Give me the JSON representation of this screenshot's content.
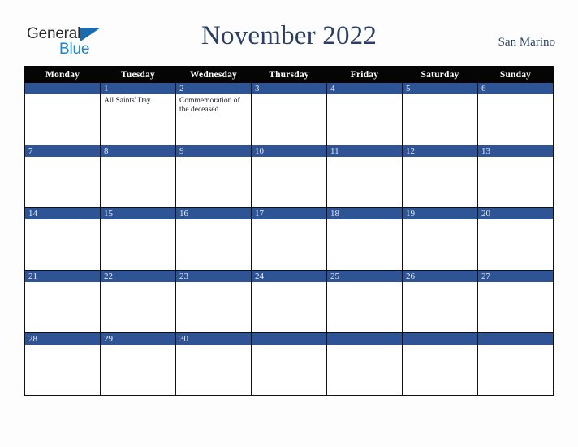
{
  "logo": {
    "word_one": "General",
    "word_two": "Blue",
    "triangle_color": "#1a6cb0",
    "text_color": "#2b2b2b",
    "blue_color": "#1e84c8"
  },
  "header": {
    "title": "November 2022",
    "locale": "San Marino",
    "title_color": "#2b3f64"
  },
  "calendar": {
    "header_bg": "#050505",
    "daybar_bg": "#2f5496",
    "cell_bg": "#ffffff",
    "weekday_headers": [
      "Monday",
      "Tuesday",
      "Wednesday",
      "Thursday",
      "Friday",
      "Saturday",
      "Sunday"
    ],
    "weeks": [
      [
        {
          "day": "",
          "event": ""
        },
        {
          "day": "1",
          "event": "All Saints' Day"
        },
        {
          "day": "2",
          "event": "Commemoration of the deceased"
        },
        {
          "day": "3",
          "event": ""
        },
        {
          "day": "4",
          "event": ""
        },
        {
          "day": "5",
          "event": ""
        },
        {
          "day": "6",
          "event": ""
        }
      ],
      [
        {
          "day": "7",
          "event": ""
        },
        {
          "day": "8",
          "event": ""
        },
        {
          "day": "9",
          "event": ""
        },
        {
          "day": "10",
          "event": ""
        },
        {
          "day": "11",
          "event": ""
        },
        {
          "day": "12",
          "event": ""
        },
        {
          "day": "13",
          "event": ""
        }
      ],
      [
        {
          "day": "14",
          "event": ""
        },
        {
          "day": "15",
          "event": ""
        },
        {
          "day": "16",
          "event": ""
        },
        {
          "day": "17",
          "event": ""
        },
        {
          "day": "18",
          "event": ""
        },
        {
          "day": "19",
          "event": ""
        },
        {
          "day": "20",
          "event": ""
        }
      ],
      [
        {
          "day": "21",
          "event": ""
        },
        {
          "day": "22",
          "event": ""
        },
        {
          "day": "23",
          "event": ""
        },
        {
          "day": "24",
          "event": ""
        },
        {
          "day": "25",
          "event": ""
        },
        {
          "day": "26",
          "event": ""
        },
        {
          "day": "27",
          "event": ""
        }
      ],
      [
        {
          "day": "28",
          "event": ""
        },
        {
          "day": "29",
          "event": ""
        },
        {
          "day": "30",
          "event": ""
        },
        {
          "day": "",
          "event": ""
        },
        {
          "day": "",
          "event": ""
        },
        {
          "day": "",
          "event": ""
        },
        {
          "day": "",
          "event": ""
        }
      ]
    ]
  }
}
